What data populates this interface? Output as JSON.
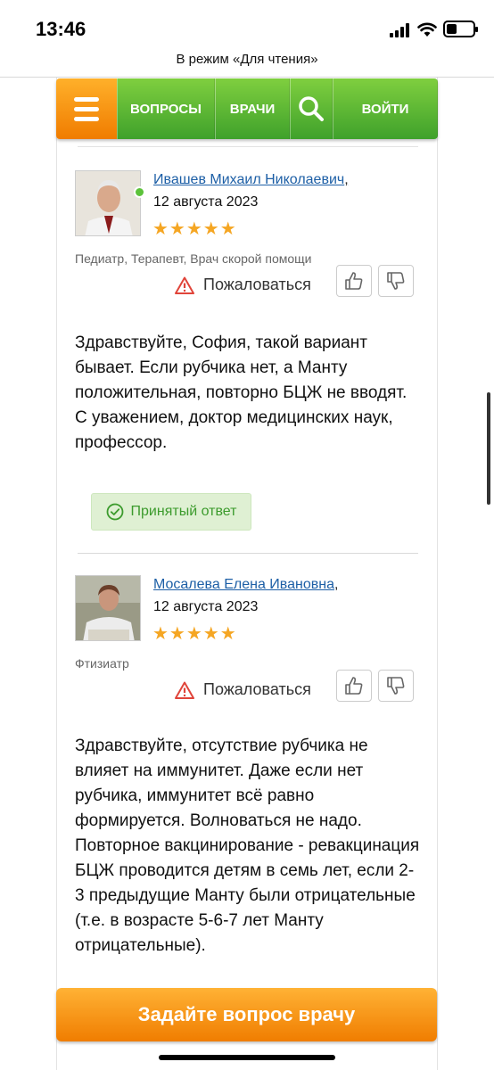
{
  "status_bar": {
    "time": "13:46"
  },
  "reader_mode": {
    "label": "В режим «Для чтения»"
  },
  "nav": {
    "questions": "ВОПРОСЫ",
    "doctors": "ВРАЧИ",
    "login": "ВОЙТИ"
  },
  "answers": [
    {
      "doctor_name": "Ивашев Михаил Николаевич",
      "date": "12 августа 2023",
      "rating_stars": 5,
      "stars": "★★★★★",
      "specialty": "Педиатр, Терапевт, Врач скорой помощи",
      "complain": "Пожаловаться",
      "text": "Здравствуйте, София, такой вариант бывает. Если рубчика нет, а Манту положительная, повторно БЦЖ не вводят.\nС уважением, доктор медицинских наук, профессор.",
      "accepted_label": "Принятый ответ"
    },
    {
      "doctor_name": "Мосалева Елена Ивановна",
      "date": "12 августа 2023",
      "rating_stars": 5,
      "stars": "★★★★★",
      "specialty": "Фтизиатр",
      "complain": "Пожаловаться",
      "text": "Здравствуйте, отсутствие рубчика не влияет на иммунитет. Даже если нет рубчика, иммунитет всё равно формируется. Волноваться не надо. Повторное вакцинирование - ревакцинация БЦЖ проводится детям в семь лет, если 2-3 предыдущие Манту были отрицательные (т.е. в возрасте 5-6-7 лет Манту отрицательные)."
    }
  ],
  "ask_button": "Задайте вопрос врачу",
  "colors": {
    "orange": "#f39200",
    "green": "#4fb22f",
    "link": "#1d5fa6",
    "star": "#f5a623"
  }
}
